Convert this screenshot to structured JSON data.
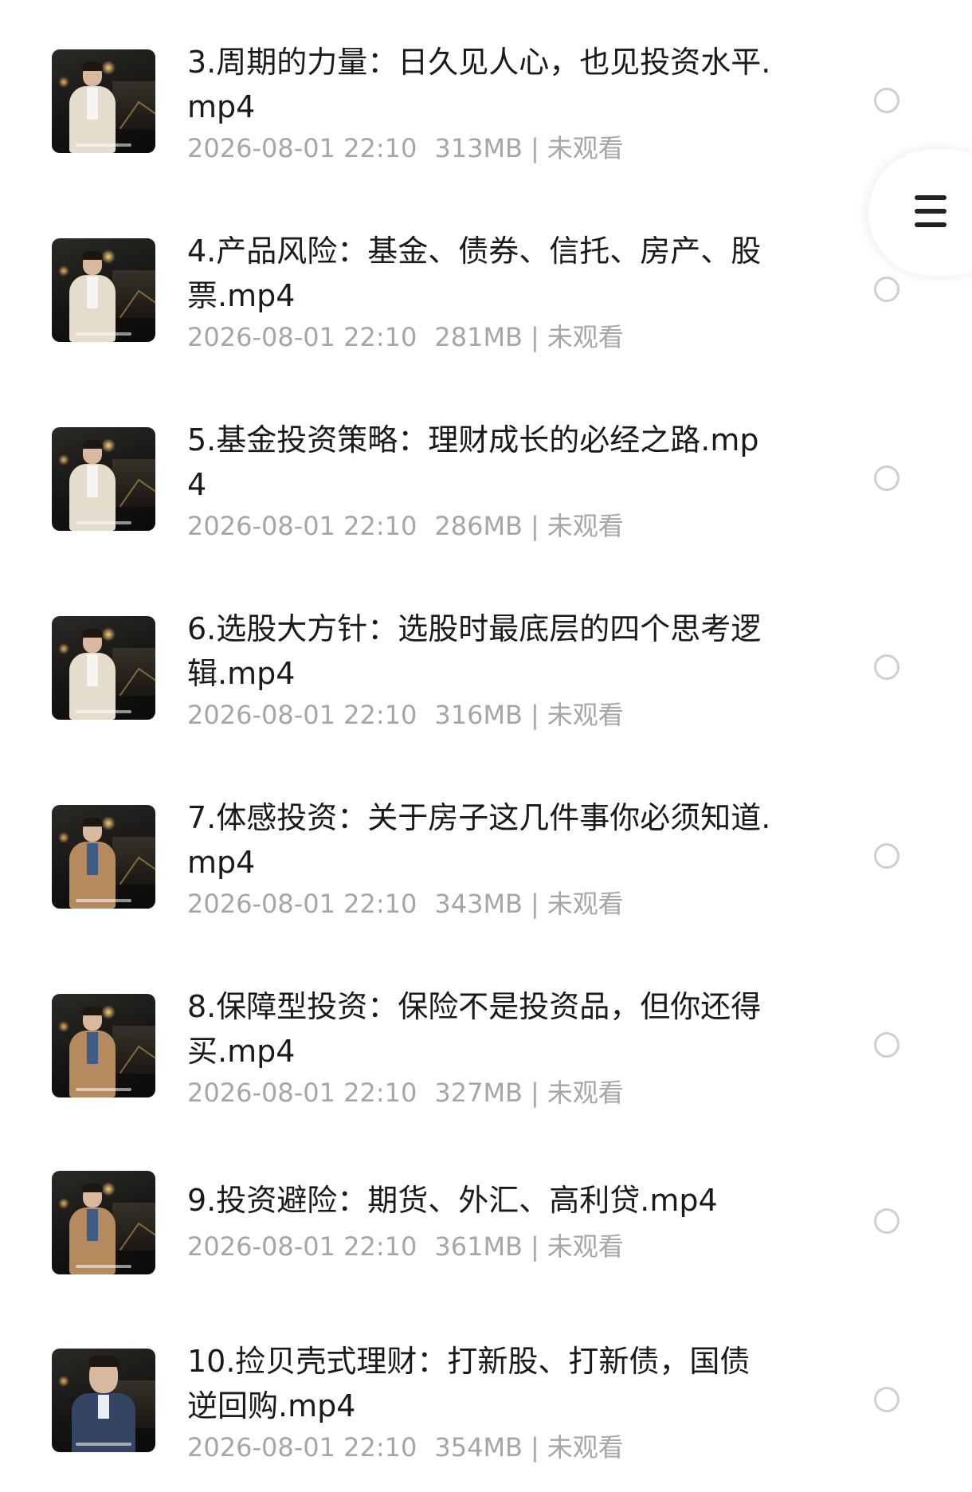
{
  "files": [
    {
      "name": "3.周期的力量：日久见人心，也见投资水平.mp4",
      "date": "2026-08-01 22:10",
      "size": "313MB",
      "status": "未观看",
      "thumb_icon": "video-thumbnail"
    },
    {
      "name": "4.产品风险：基金、债券、信托、房产、股票.mp4",
      "date": "2026-08-01 22:10",
      "size": "281MB",
      "status": "未观看",
      "thumb_icon": "video-thumbnail"
    },
    {
      "name": "5.基金投资策略：理财成长的必经之路.mp4",
      "date": "2026-08-01 22:10",
      "size": "286MB",
      "status": "未观看",
      "thumb_icon": "video-thumbnail"
    },
    {
      "name": "6.选股大方针：选股时最底层的四个思考逻辑.mp4",
      "date": "2026-08-01 22:10",
      "size": "316MB",
      "status": "未观看",
      "thumb_icon": "video-thumbnail"
    },
    {
      "name": "7.体感投资：关于房子这几件事你必须知道.mp4",
      "date": "2026-08-01 22:10",
      "size": "343MB",
      "status": "未观看",
      "thumb_icon": "video-thumbnail"
    },
    {
      "name": "8.保障型投资：保险不是投资品，但你还得买.mp4",
      "date": "2026-08-01 22:10",
      "size": "327MB",
      "status": "未观看",
      "thumb_icon": "video-thumbnail"
    },
    {
      "name": "9.投资避险：期货、外汇、高利贷.mp4",
      "date": "2026-08-01 22:10",
      "size": "361MB",
      "status": "未观看",
      "thumb_icon": "video-thumbnail"
    },
    {
      "name": "10.捡贝壳式理财：打新股、打新债，国债逆回购.mp4",
      "date": "2026-08-01 22:10",
      "size": "354MB",
      "status": "未观看",
      "thumb_icon": "video-thumbnail"
    }
  ],
  "separator": "|",
  "menu_icon": "hamburger-menu-icon",
  "select_icon": "radio-circle-icon"
}
